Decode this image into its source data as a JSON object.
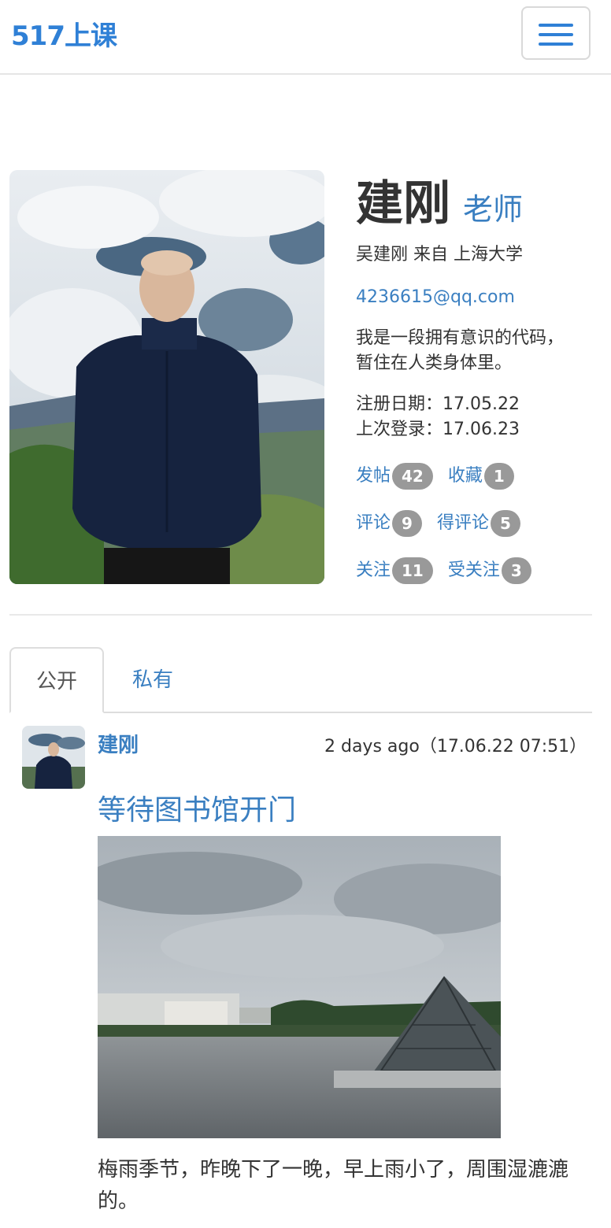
{
  "navbar": {
    "brand": "517上课",
    "menu_icon": "hamburger-icon"
  },
  "profile": {
    "name": "建刚",
    "role": "老师",
    "fullname_line": "吴建刚  来自 上海大学",
    "email": "4236615@qq.com",
    "bio_line1": "我是一段拥有意识的代码，",
    "bio_line2": "暂住在人类身体里。",
    "registered": "注册日期：17.05.22",
    "last_login": "上次登录：17.06.23",
    "stats": {
      "posts": {
        "label": "发帖",
        "count": "42"
      },
      "favorites": {
        "label": "收藏",
        "count": "1"
      },
      "comments": {
        "label": "评论",
        "count": "9"
      },
      "received_comments": {
        "label": "得评论",
        "count": "5"
      },
      "following": {
        "label": "关注",
        "count": "11"
      },
      "followers": {
        "label": "受关注",
        "count": "3"
      }
    }
  },
  "tabs": [
    {
      "label": "公开",
      "active": true
    },
    {
      "label": "私有",
      "active": false
    }
  ],
  "post": {
    "author": "建刚",
    "time": "2 days ago（17.06.22 07:51）",
    "title": "等待图书馆开门",
    "body": "梅雨季节，昨晚下了一晚，早上雨小了，周围湿漉漉的。"
  },
  "colors": {
    "brand": "#2f80d6",
    "link": "#3a7fc1",
    "badge": "#999999"
  }
}
